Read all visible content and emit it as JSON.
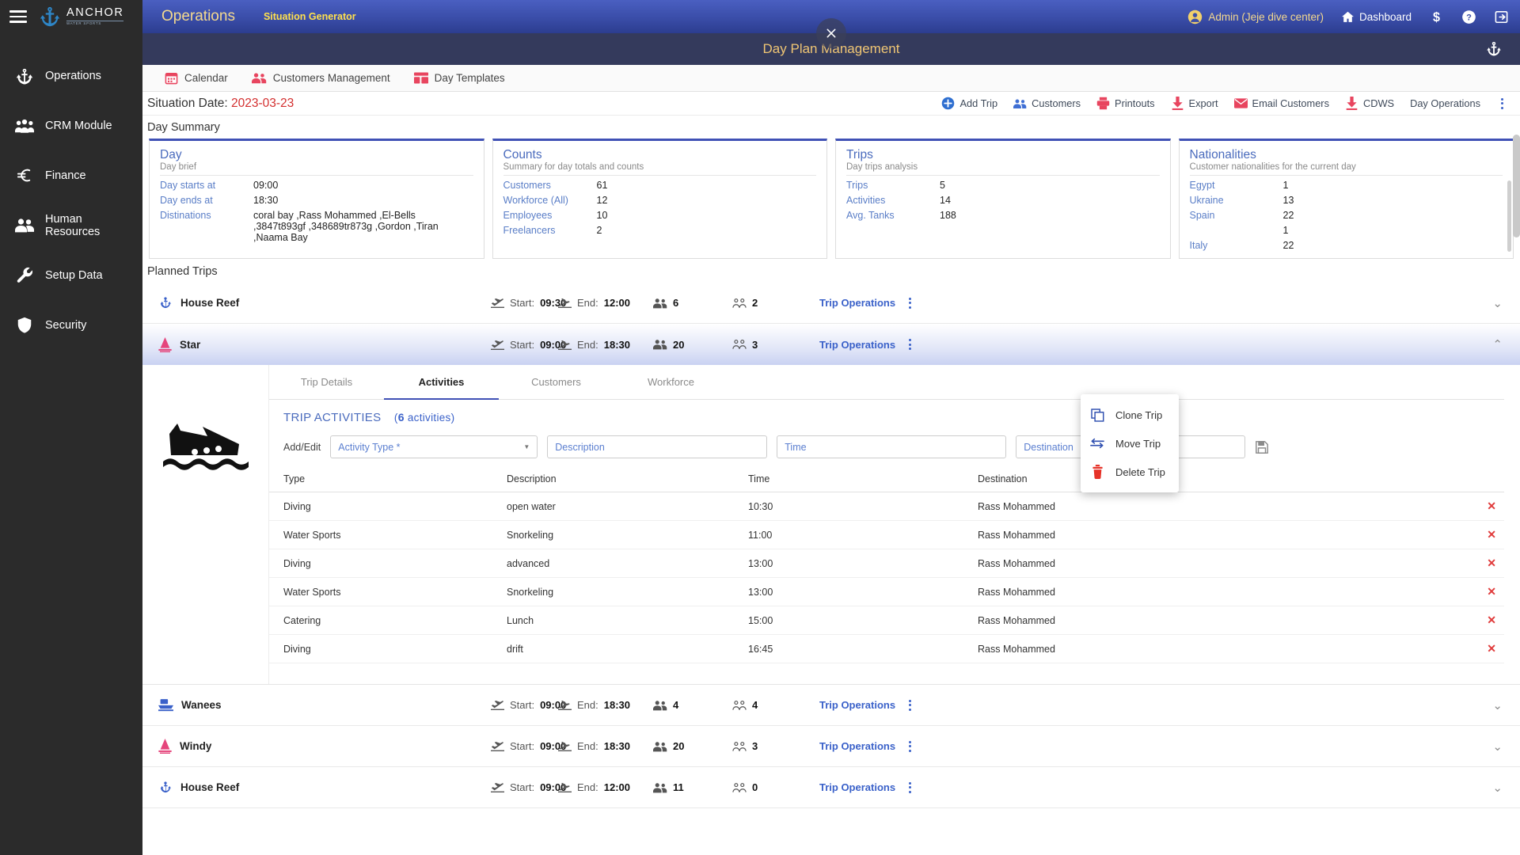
{
  "sidebar": {
    "brand": {
      "name": "ANCHOR",
      "sub": "WATER SPORTS"
    },
    "items": [
      {
        "label": "Operations",
        "icon": "anchor-icon"
      },
      {
        "label": "CRM Module",
        "icon": "people-group-icon"
      },
      {
        "label": "Finance",
        "icon": "euro-icon"
      },
      {
        "label": "Human Resources",
        "icon": "two-people-icon"
      },
      {
        "label": "Setup Data",
        "icon": "wrench-icon"
      },
      {
        "label": "Security",
        "icon": "shield-icon"
      }
    ]
  },
  "topbar": {
    "title": "Operations",
    "subtitle": "Situation Generator",
    "user": "Admin (Jeje dive center)",
    "dashboard": "Dashboard",
    "icons": [
      "dollar-icon",
      "help-icon",
      "logout-icon"
    ]
  },
  "banner": {
    "title": "Day Plan Management",
    "close": "×"
  },
  "module_tabs": [
    {
      "label": "Calendar",
      "icon": "calendar-icon"
    },
    {
      "label": "Customers Management",
      "icon": "people-icon"
    },
    {
      "label": "Day Templates",
      "icon": "template-icon"
    }
  ],
  "situation": {
    "label": "Situation Date:",
    "date": "2023-03-23"
  },
  "actions": [
    {
      "label": "Add Trip",
      "icon": "plus-circle-icon"
    },
    {
      "label": "Customers",
      "icon": "people-icon"
    },
    {
      "label": "Printouts",
      "icon": "printer-icon"
    },
    {
      "label": "Export",
      "icon": "download-icon"
    },
    {
      "label": "Email Customers",
      "icon": "envelope-icon"
    },
    {
      "label": "CDWS",
      "icon": "download-icon"
    },
    {
      "label": "Day Operations",
      "icon": "none"
    }
  ],
  "day_summary": {
    "heading": "Day Summary",
    "cards": [
      {
        "title": "Day",
        "subtitle": "Day brief",
        "rows": [
          {
            "key": "Day starts at",
            "value": "09:00"
          },
          {
            "key": "Day ends at",
            "value": "18:30"
          },
          {
            "key": "Distinations",
            "value": "coral bay ,Rass Mohammed ,El-Bells ,3847t893gf ,348689tr873g ,Gordon ,Tiran ,Naama Bay"
          }
        ]
      },
      {
        "title": "Counts",
        "subtitle": "Summary for day totals and counts",
        "rows": [
          {
            "key": "Customers",
            "value": "61"
          },
          {
            "key": "Workforce (All)",
            "value": "12"
          },
          {
            "key": "Employees",
            "value": "10"
          },
          {
            "key": "Freelancers",
            "value": "2"
          }
        ]
      },
      {
        "title": "Trips",
        "subtitle": "Day trips analysis",
        "rows": [
          {
            "key": "Trips",
            "value": "5"
          },
          {
            "key": "Activities",
            "value": "14"
          },
          {
            "key": "Avg. Tanks",
            "value": "188"
          }
        ]
      },
      {
        "title": "Nationalities",
        "subtitle": "Customer nationalities for the current day",
        "rows": [
          {
            "key": "Egypt",
            "value": "1"
          },
          {
            "key": "Ukraine",
            "value": "13"
          },
          {
            "key": "Spain",
            "value": "22"
          },
          {
            "key": "",
            "value": "1"
          },
          {
            "key": "Italy",
            "value": "22"
          }
        ]
      }
    ]
  },
  "planned_trips": {
    "heading": "Planned Trips",
    "labels": {
      "start": "Start:",
      "end": "End:",
      "ops": "Trip Operations"
    },
    "rows": [
      {
        "name": "House Reef",
        "icon": "anchor-boat-icon",
        "icon_color": "#3a61c9",
        "start": "09:30",
        "end": "12:00",
        "pax": "6",
        "staff": "2",
        "expanded": false
      },
      {
        "name": "Star",
        "icon": "sailboat-icon",
        "icon_color": "#e5457c",
        "start": "09:00",
        "end": "18:30",
        "pax": "20",
        "staff": "3",
        "expanded": true
      },
      {
        "name": "Wanees",
        "icon": "ferry-icon",
        "icon_color": "#3a61c9",
        "start": "09:00",
        "end": "18:30",
        "pax": "4",
        "staff": "4",
        "expanded": false
      },
      {
        "name": "Windy",
        "icon": "sailboat-icon",
        "icon_color": "#e5457c",
        "start": "09:00",
        "end": "18:30",
        "pax": "20",
        "staff": "3",
        "expanded": false
      },
      {
        "name": "House Reef",
        "icon": "anchor-boat-icon",
        "icon_color": "#3a61c9",
        "start": "09:00",
        "end": "12:00",
        "pax": "11",
        "staff": "0",
        "expanded": false
      }
    ]
  },
  "trip_detail": {
    "tabs": [
      {
        "label": "Trip Details",
        "active": false
      },
      {
        "label": "Activities",
        "active": true
      },
      {
        "label": "Customers",
        "active": false
      },
      {
        "label": "Workforce",
        "active": false
      }
    ],
    "activities_title": "TRIP ACTIVITIES",
    "activities_count": "6",
    "activities_count_suffix": "activities",
    "form": {
      "label": "Add/Edit",
      "activity_type_placeholder": "Activity Type *",
      "description_placeholder": "Description",
      "time_placeholder": "Time",
      "destination_placeholder": "Destination",
      "save_icon": "save-icon"
    },
    "columns": [
      "Type",
      "Description",
      "Time",
      "Destination"
    ],
    "rows": [
      {
        "type": "Diving",
        "description": "open water",
        "time": "10:30",
        "destination": "Rass Mohammed"
      },
      {
        "type": "Water Sports",
        "description": "Snorkeling",
        "time": "11:00",
        "destination": "Rass Mohammed"
      },
      {
        "type": "Diving",
        "description": "advanced",
        "time": "13:00",
        "destination": "Rass Mohammed"
      },
      {
        "type": "Water Sports",
        "description": "Snorkeling",
        "time": "13:00",
        "destination": "Rass Mohammed"
      },
      {
        "type": "Catering",
        "description": "Lunch",
        "time": "15:00",
        "destination": "Rass Mohammed"
      },
      {
        "type": "Diving",
        "description": "drift",
        "time": "16:45",
        "destination": "Rass Mohammed"
      }
    ],
    "delete_symbol": "✕"
  },
  "context_menu": {
    "items": [
      {
        "label": "Clone Trip",
        "icon": "copy-icon"
      },
      {
        "label": "Move Trip",
        "icon": "move-arrows-icon"
      },
      {
        "label": "Delete Trip",
        "icon": "trash-icon"
      }
    ]
  }
}
